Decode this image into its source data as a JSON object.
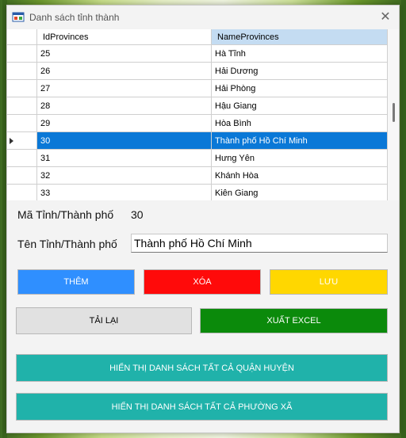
{
  "window": {
    "title": "Danh sách tỉnh thành",
    "close_label": "✕"
  },
  "grid": {
    "columns": [
      "IdProvinces",
      "NameProvinces"
    ],
    "rows": [
      {
        "id": "25",
        "name": "Hà Tĩnh"
      },
      {
        "id": "26",
        "name": "Hải Dương"
      },
      {
        "id": "27",
        "name": "Hải Phòng"
      },
      {
        "id": "28",
        "name": "Hậu Giang"
      },
      {
        "id": "29",
        "name": "Hòa Bình"
      },
      {
        "id": "30",
        "name": "Thành phố Hồ Chí Minh"
      },
      {
        "id": "31",
        "name": "Hưng Yên"
      },
      {
        "id": "32",
        "name": "Khánh Hòa"
      },
      {
        "id": "33",
        "name": "Kiên Giang"
      }
    ],
    "selected_row": 5
  },
  "form": {
    "ma_label": "Mã Tỉnh/Thành phố",
    "ma_value": "30",
    "ten_label": "Tên Tỉnh/Thành phố",
    "ten_value": "Thành phố Hồ Chí Minh"
  },
  "buttons": {
    "them": "THÊM",
    "xoa": "XÓA",
    "luu": "LƯU",
    "tai_lai": "TẢI LẠI",
    "xuat_excel": "XUẤT EXCEL",
    "quan_huyen": "HIỂN THỊ DANH SÁCH TẤT CẢ QUẬN HUYỆN",
    "phuong_xa": "HIỂN THỊ DANH SÁCH TẤT CẢ PHƯỜNG XÃ"
  },
  "colors": {
    "selection": "#0a78d7",
    "them": "#2f8fff",
    "xoa": "#ff0a0a",
    "luu": "#ffd700",
    "xuat_excel": "#0b8a0b",
    "teal": "#20b2aa"
  }
}
